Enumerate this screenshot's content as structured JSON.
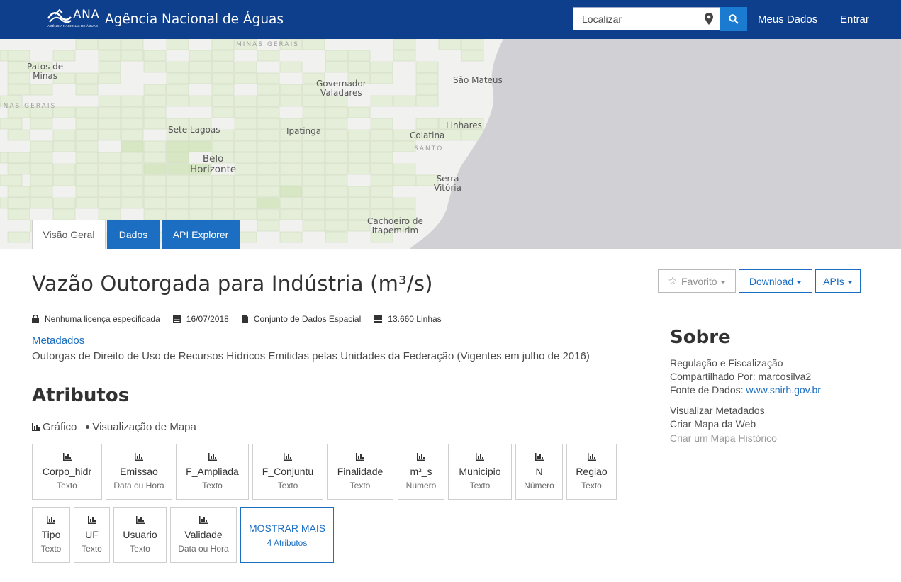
{
  "header": {
    "logo_text": "ANA",
    "logo_subtext": "AGÊNCIA NACIONAL DE ÁGUAS",
    "site_title": "Agência Nacional de Águas",
    "search_placeholder": "Localizar",
    "nav": [
      "Meus Dados",
      "Entrar"
    ],
    "bar_color": "#0e3f8c",
    "accent_color": "#1b7bd0"
  },
  "map": {
    "labels": [
      "MINAS GERAIS",
      "Patos de\nMinas",
      "INAS GERAIS",
      "Governador\nValadares",
      "São Mateus",
      "Sete Lagoas",
      "Ipatinga",
      "Linhares",
      "Colatina",
      "SANTO",
      "Belo\nHorizonte",
      "Serra\nVitória",
      "Cachoeiro de\nItapemirim"
    ]
  },
  "tabs": [
    "Visão Geral",
    "Dados",
    "API Explorer"
  ],
  "page": {
    "title": "Vazão Outorgada para Indústria (m³/s)",
    "buttons": {
      "favorite": "Favorito",
      "download": "Download",
      "apis": "APIs"
    },
    "meta": {
      "license": "Nenhuma licença especificada",
      "date": "16/07/2018",
      "type": "Conjunto de Dados Espacial",
      "rows": "13.660 Linhas"
    },
    "metadata_link": "Metadados",
    "description": "Outorgas de Direito de Uso de Recursos Hídricos Emitidas pelas Unidades da Federação (Vigentes em julho de 2016)"
  },
  "attributes": {
    "heading": "Atributos",
    "view_chart": "Gráfico",
    "view_map": "Visualização de Mapa",
    "items": [
      {
        "name": "Corpo_hidr",
        "type": "Texto"
      },
      {
        "name": "Emissao",
        "type": "Data ou Hora"
      },
      {
        "name": "F_Ampliada",
        "type": "Texto"
      },
      {
        "name": "F_Conjuntu",
        "type": "Texto"
      },
      {
        "name": "Finalidade",
        "type": "Texto"
      },
      {
        "name": "m3_s",
        "name_display": "m³_s",
        "type": "Número"
      },
      {
        "name": "Municipio",
        "type": "Texto"
      },
      {
        "name": "N",
        "type": "Número"
      },
      {
        "name": "Regiao",
        "type": "Texto"
      },
      {
        "name": "Tipo",
        "type": "Texto"
      },
      {
        "name": "UF",
        "type": "Texto"
      },
      {
        "name": "Usuario",
        "type": "Texto"
      },
      {
        "name": "Validade",
        "type": "Data ou Hora"
      }
    ],
    "show_more": {
      "label": "MOSTRAR MAIS",
      "count": "4 Atributos"
    }
  },
  "sidebar": {
    "heading": "Sobre",
    "category_link": "Regulação e Fiscalização",
    "shared_by_label": "Compartilhado Por:",
    "shared_by": "marcosilva2",
    "source_label": "Fonte de Dados:",
    "source_link": "www.snirh.gov.br",
    "links": [
      "Visualizar Metadados",
      "Criar Mapa da Web"
    ],
    "disabled_link": "Criar um Mapa Histórico"
  }
}
